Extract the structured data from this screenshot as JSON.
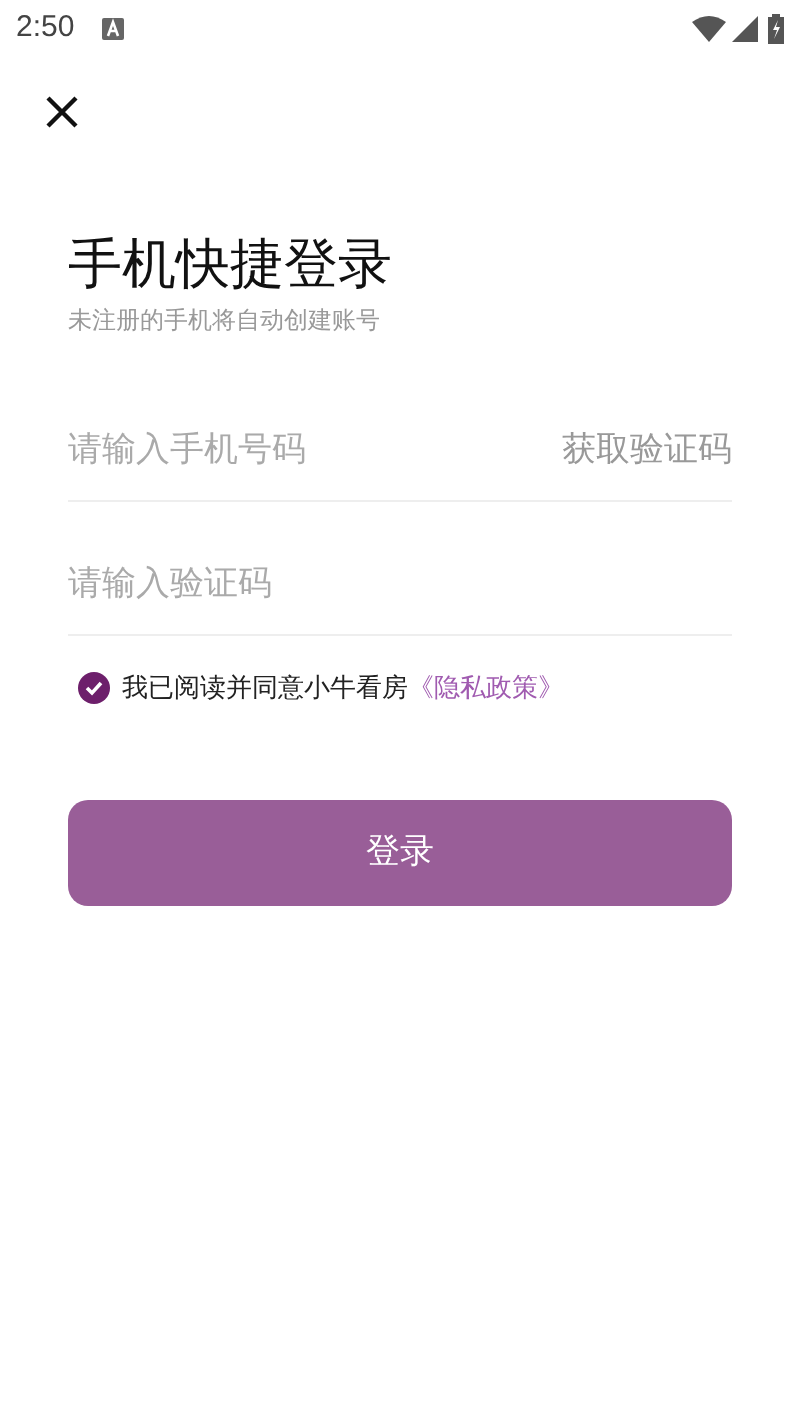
{
  "status_bar": {
    "time": "2:50"
  },
  "title": "手机快捷登录",
  "subtitle": "未注册的手机将自动创建账号",
  "phone_field": {
    "placeholder": "请输入手机号码"
  },
  "get_code_button": "获取验证码",
  "code_field": {
    "placeholder": "请输入验证码"
  },
  "agreement": {
    "checked": true,
    "text": "我已阅读并同意小牛看房",
    "link": "《隐私政策》"
  },
  "login_button": "登录"
}
